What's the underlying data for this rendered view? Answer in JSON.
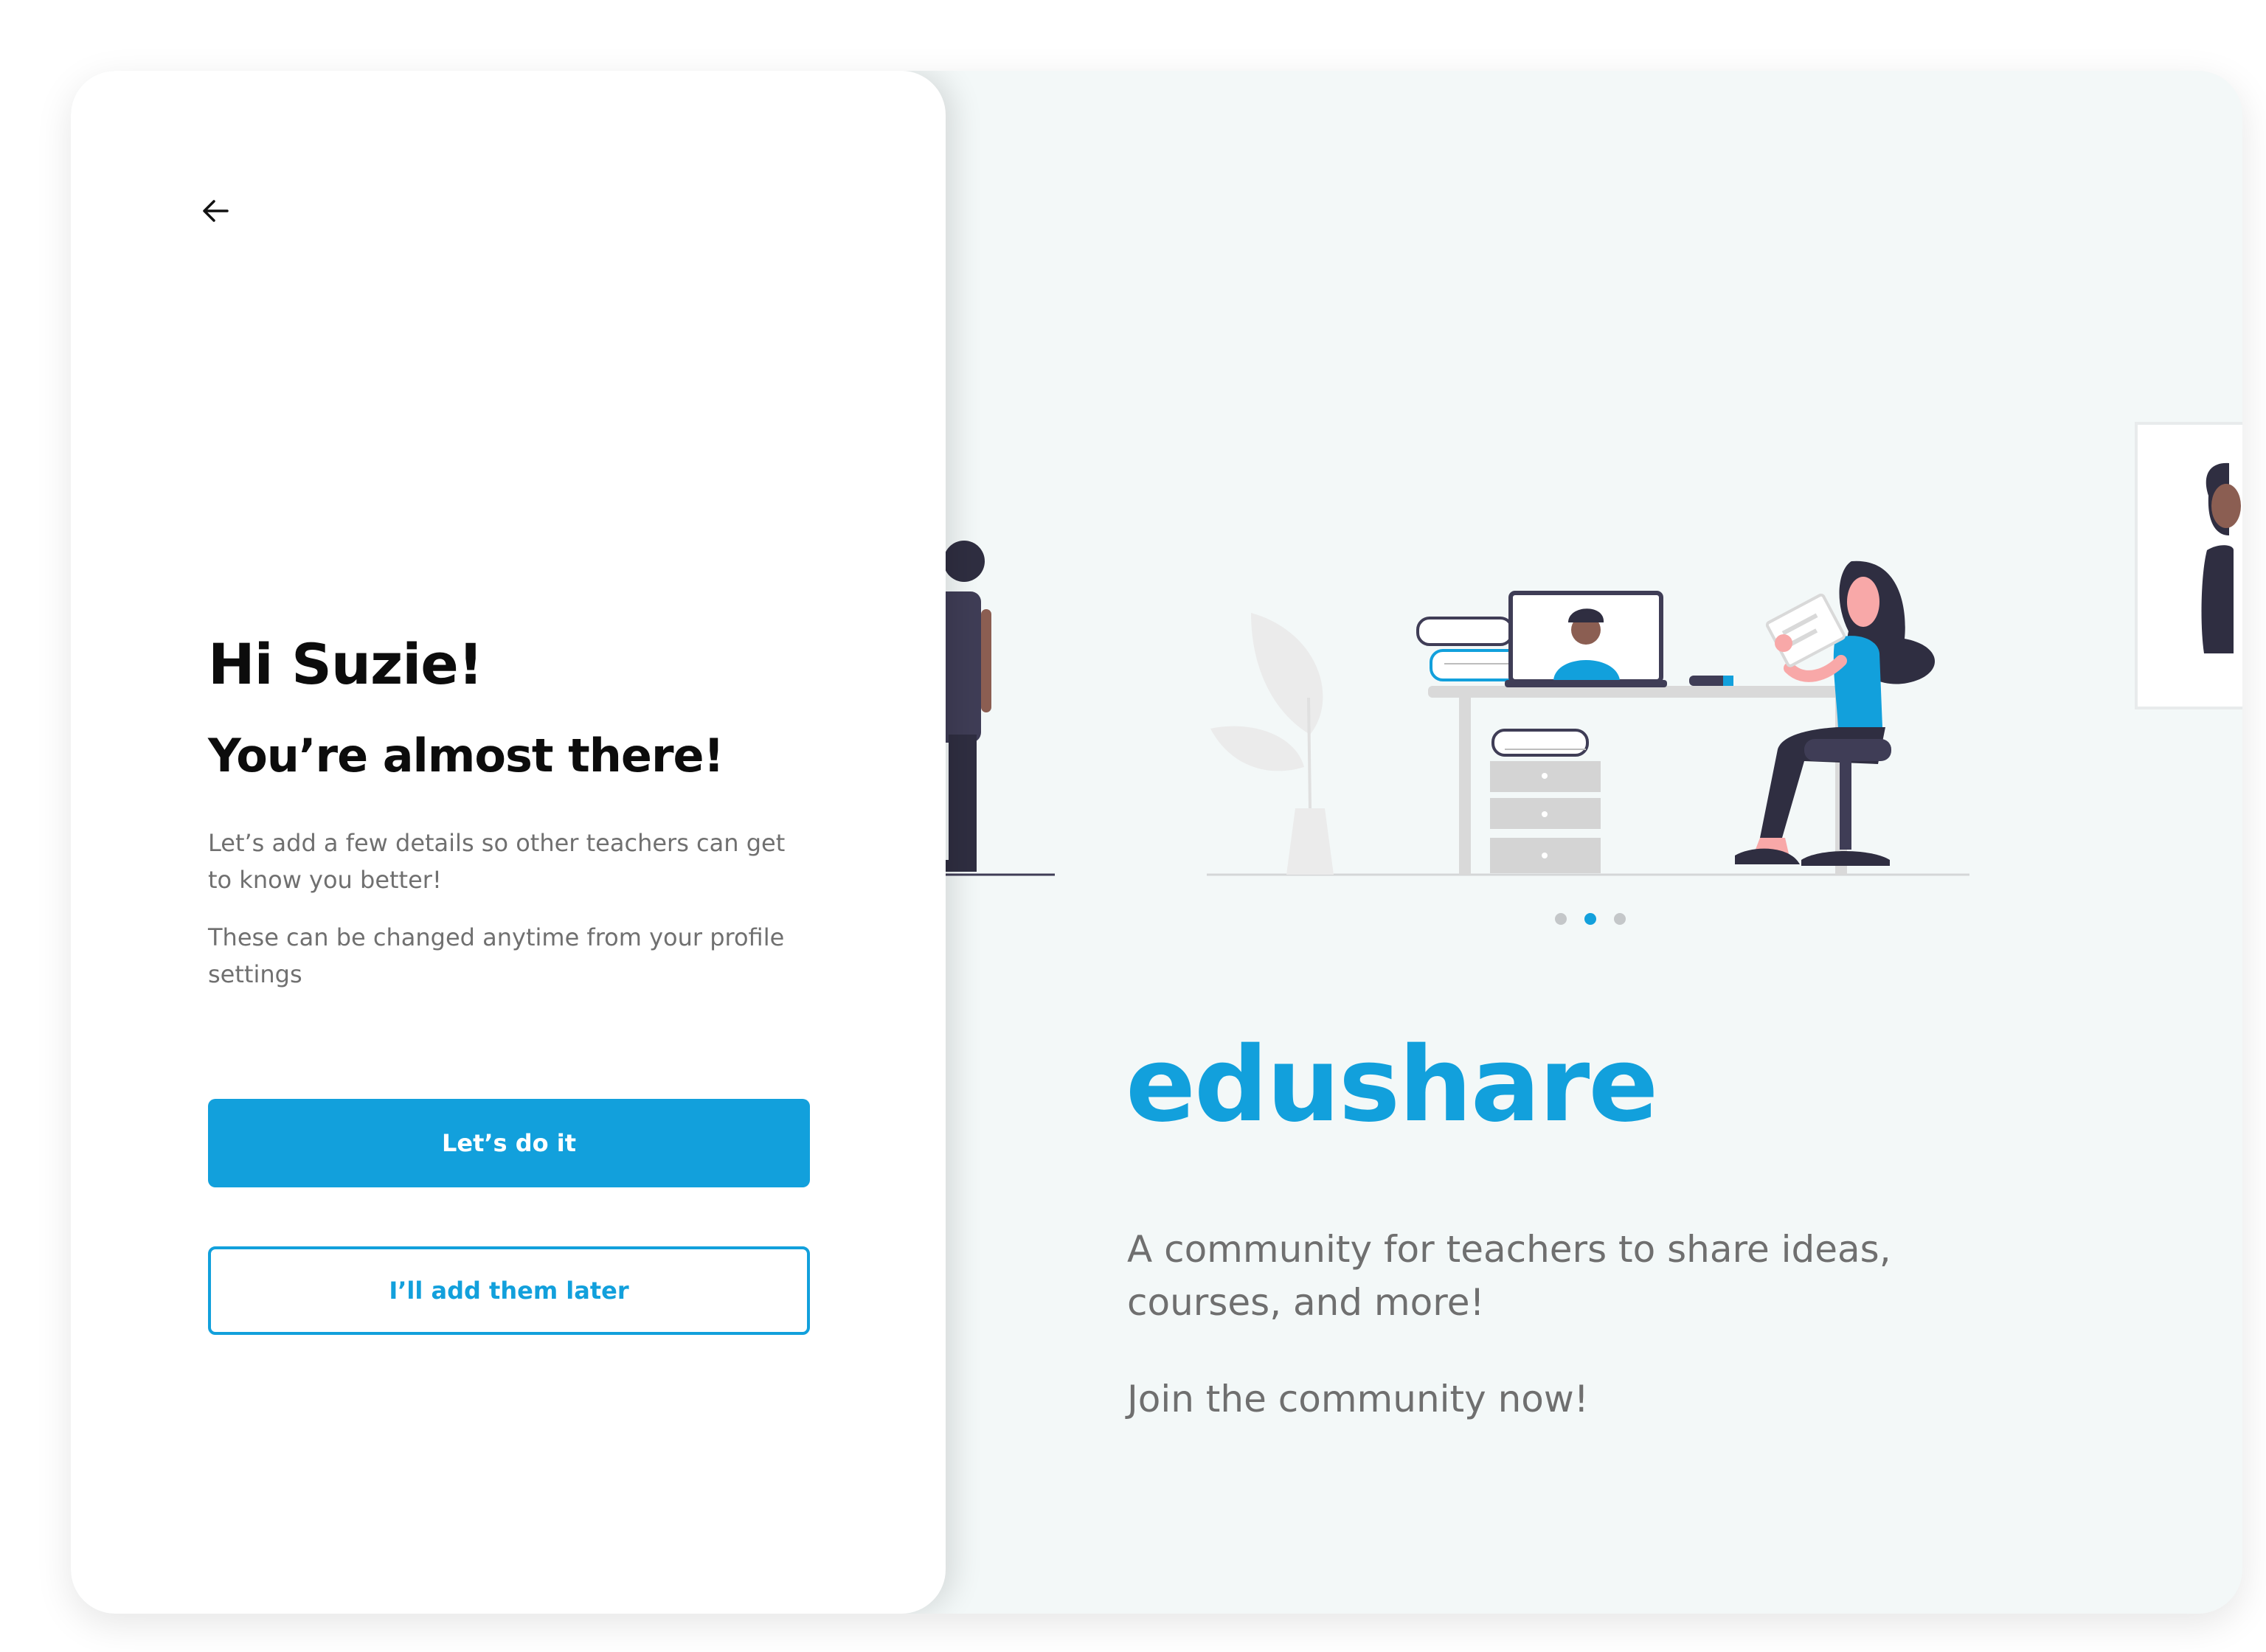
{
  "left_panel": {
    "back_icon": "arrow-left-icon",
    "greeting": "Hi Suzie!",
    "subheading": "You’re almost there!",
    "paragraph_1": "Let’s add a few details so other teachers can get to know you better!",
    "paragraph_2": "These can be changed anytime from your profile settings",
    "primary_button": "Let’s do it",
    "secondary_button": "I’ll add them later"
  },
  "right_panel": {
    "brand": "edushare",
    "tagline": "A community for teachers to share ideas, courses, and more!",
    "cta": "Join the community now!",
    "carousel": {
      "slide_count": 3,
      "active_index": 1
    }
  },
  "colors": {
    "accent": "#12a0dc",
    "panel_bg": "#f3f8f8",
    "heading": "#0c0c0c",
    "body_text": "#707070",
    "figure_dark": "#2f2e41"
  }
}
